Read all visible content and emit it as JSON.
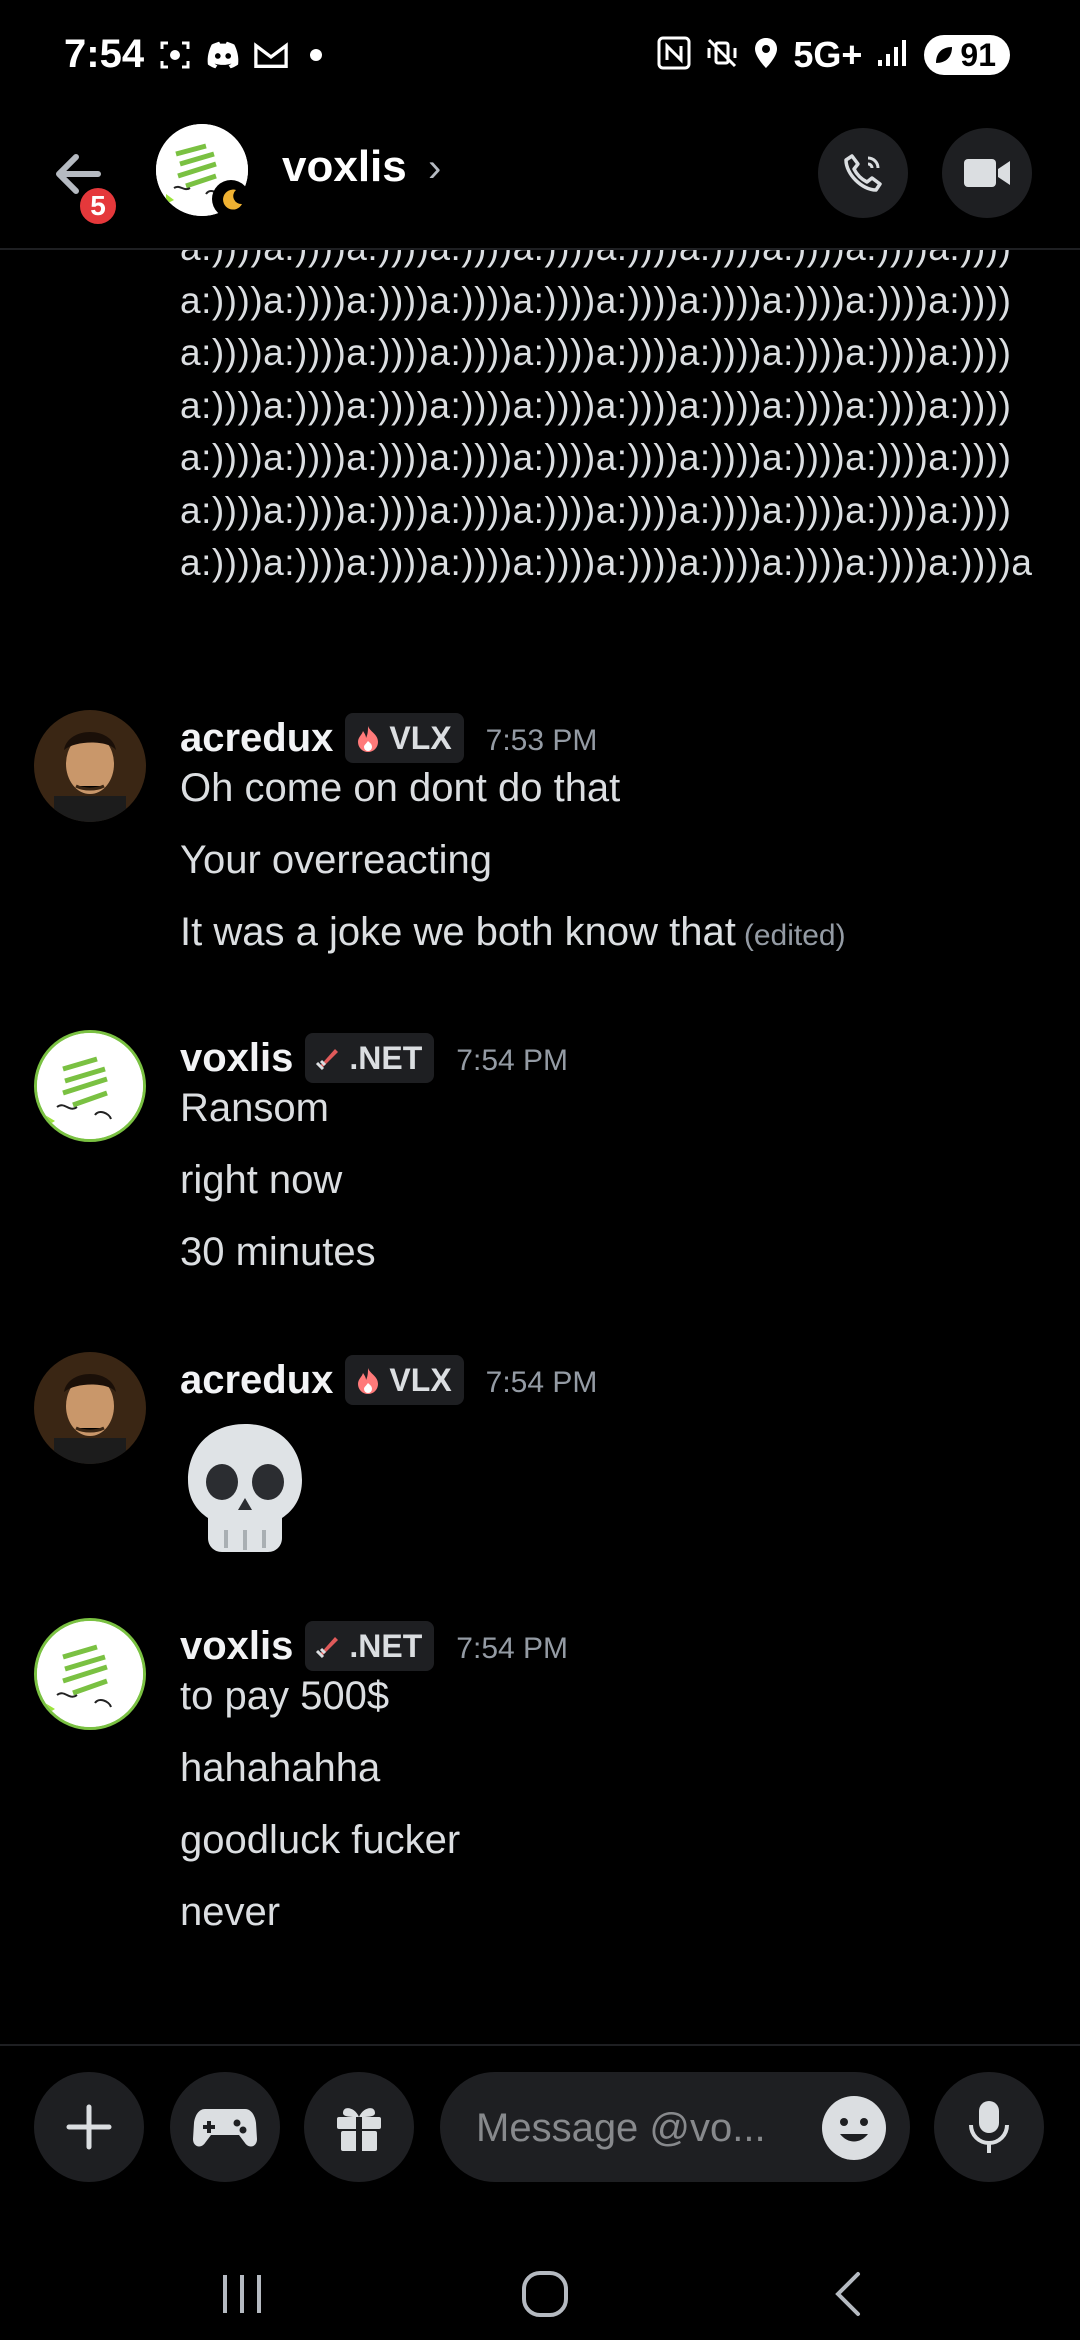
{
  "status_bar": {
    "time": "7:54",
    "network": "5G+",
    "battery": "91"
  },
  "header": {
    "title": "voxlis",
    "unread_badge": "5"
  },
  "chat": {
    "spam_text": "a:))))a:))))a:))))a:))))a:))))a:))))a:))))a:))))a:))))a:))))a:))))a:))))a:))))a:))))a:))))a:))))a:))))a:))))a:))))a:))))a:))))a:))))a:))))a:))))a:))))a:))))a:))))a:))))a:))))a:))))a:))))a:))))a:))))a:))))a:))))a:))))a:))))a:))))a:))))a:))))a:))))a:))))a:))))a:))))a:))))a:))))a:))))a:))))a:))))a:))))a:))))a:))))a:))))a:))))a:))))a:))))a:))))a:))))a:))))a:))))a:))))a:))))a:))))a:))))a:))))a:))))a:))))a:))))a:))))a:))))a",
    "groups": [
      {
        "user": "acredux",
        "tag": "VLX",
        "time": "7:53 PM",
        "lines": [
          "Oh come on dont do that",
          "Your overreacting",
          "It was a joke we both know that"
        ],
        "edited": "(edited)"
      },
      {
        "user": "voxlis",
        "tag": ".NET",
        "time": "7:54 PM",
        "lines": [
          "Ransom",
          "right now",
          "30 minutes"
        ]
      },
      {
        "user": "acredux",
        "tag": "VLX",
        "time": "7:54 PM",
        "emoji": "skull"
      },
      {
        "user": "voxlis",
        "tag": ".NET",
        "time": "7:54 PM",
        "lines": [
          "to pay 500$",
          "hahahahha",
          "goodluck fucker",
          "never"
        ]
      }
    ]
  },
  "composer": {
    "placeholder": "Message @vo..."
  }
}
